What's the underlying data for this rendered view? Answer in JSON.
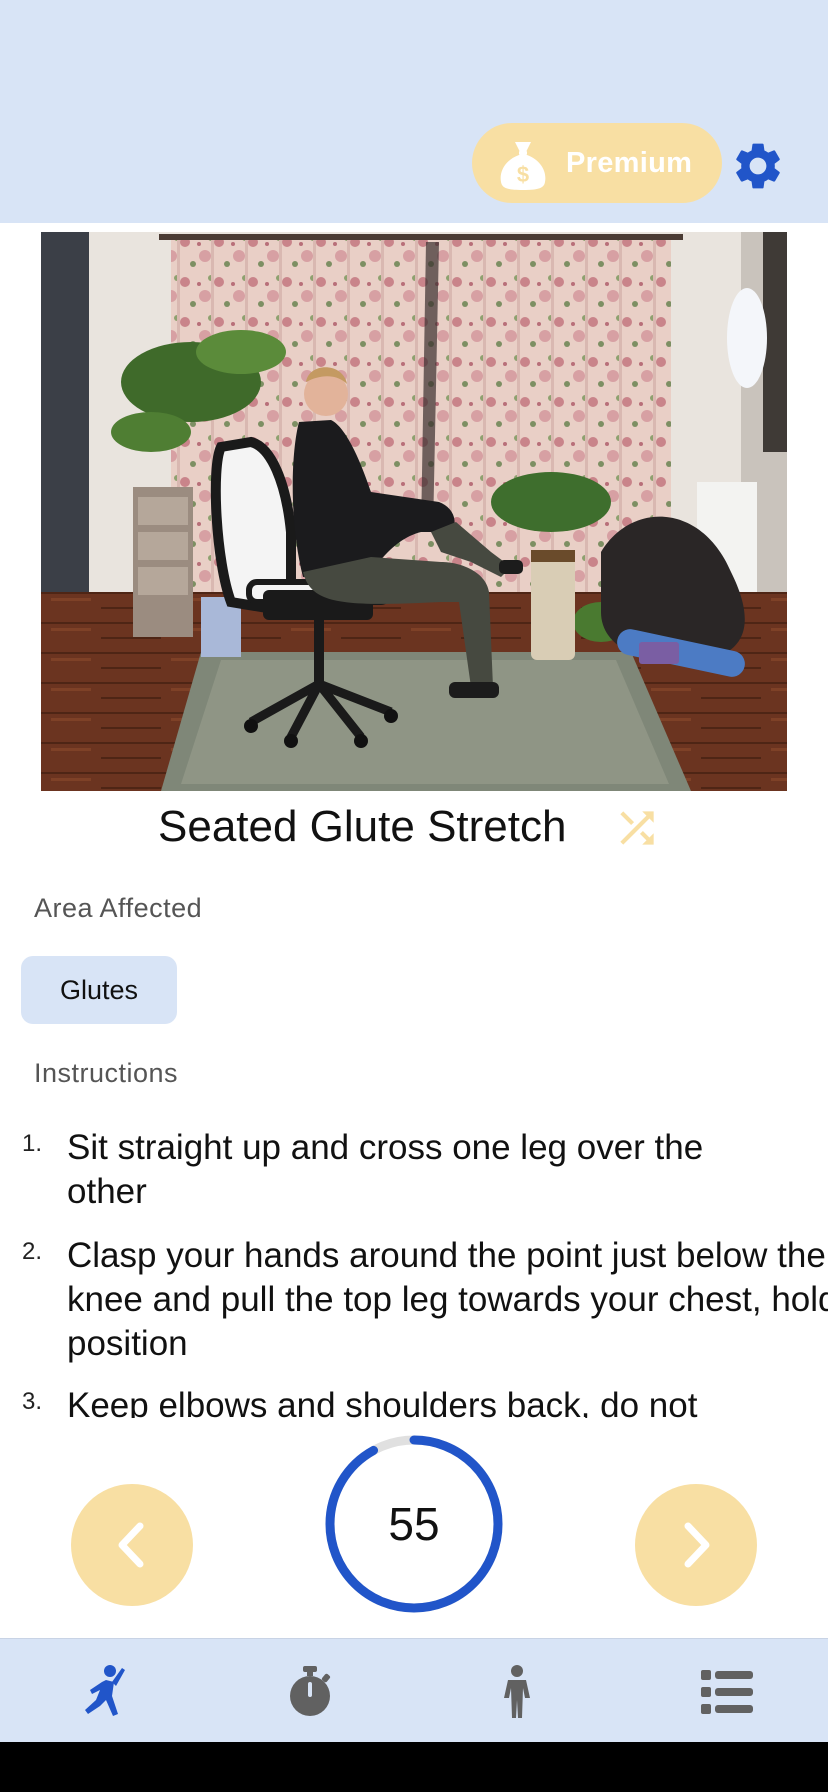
{
  "header": {
    "premium_label": "Premium",
    "premium_icon": "money-bag-icon",
    "settings_icon": "gear-icon"
  },
  "exercise": {
    "image_alt": "Person performing seated glute stretch on office chair",
    "title": "Seated Glute Stretch",
    "shuffle_icon": "shuffle-icon"
  },
  "area": {
    "label": "Area Affected",
    "chips": [
      "Glutes"
    ]
  },
  "instructions": {
    "label": "Instructions",
    "steps": [
      {
        "num": "1.",
        "text": "Sit straight up and cross one leg over the other"
      },
      {
        "num": "2.",
        "text": "Clasp your hands around the point just below the knee and pull the top leg towards your chest, hold position"
      },
      {
        "num": "3.",
        "text": "Keep elbows and shoulders back, do not"
      }
    ]
  },
  "timer": {
    "seconds": "55",
    "progress_fraction": 0.92
  },
  "controls": {
    "prev_icon": "chevron-left-icon",
    "next_icon": "chevron-right-icon"
  },
  "nav": {
    "items": [
      {
        "icon": "stretch-icon",
        "active": true
      },
      {
        "icon": "stopwatch-icon",
        "active": false
      },
      {
        "icon": "person-icon",
        "active": false
      },
      {
        "icon": "list-icon",
        "active": false
      }
    ]
  },
  "colors": {
    "header_bg": "#d8e4f6",
    "accent_yellow": "#f8dfa3",
    "primary_blue": "#2155c9",
    "icon_gray": "#616161"
  }
}
